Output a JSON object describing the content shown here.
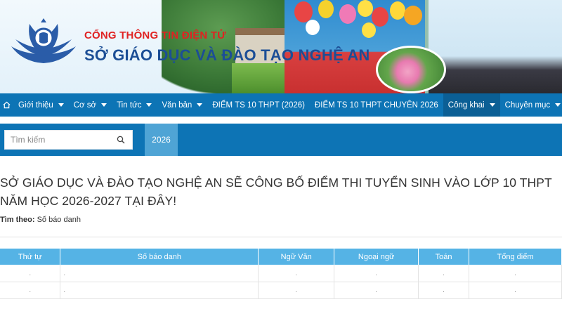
{
  "header": {
    "subtitle": "CỔNG THÔNG TIN ĐIỆN TỬ",
    "title": "SỞ GIÁO DỤC VÀ ĐÀO TẠO NGHỆ AN"
  },
  "nav": {
    "items": [
      {
        "label": "Giới thiệu"
      },
      {
        "label": "Cơ sở"
      },
      {
        "label": "Tin tức"
      },
      {
        "label": "Văn bản"
      },
      {
        "label": "ĐIỂM TS 10 THPT (2026)"
      },
      {
        "label": "ĐIỂM TS 10 THPT CHUYÊN 2026"
      },
      {
        "label": "Công khai"
      },
      {
        "label": "Chuyên mục"
      }
    ]
  },
  "search": {
    "placeholder": "Tìm kiếm",
    "year_tab": "2026"
  },
  "main": {
    "headline": "SỞ GIÁO DỤC VÀ ĐÀO TẠO NGHỆ AN SẼ CÔNG BỐ ĐIỂM THI TUYỂN SINH VÀO LỚP 10 THPT NĂM HỌC 2026-2027 TẠI ĐÂY!",
    "search_by_label": "Tìm theo:",
    "search_by_value": "Số báo danh"
  },
  "table": {
    "headers": [
      "Thứ tự",
      "Số báo danh",
      "Ngữ Văn",
      "Ngoại ngữ",
      "Toán",
      "Tổng điểm"
    ],
    "rows": [
      [
        ".",
        ".",
        ".",
        ".",
        ".",
        "."
      ],
      [
        ".",
        ".",
        ".",
        ".",
        ".",
        "."
      ]
    ]
  },
  "colors": {
    "nav_bg": "#0d74b5",
    "nav_active": "#0b5f95",
    "year_tab": "#4fa4d5",
    "table_header": "#55b3e5",
    "title_blue": "#1c4e96",
    "subtitle_red": "#e02222"
  }
}
